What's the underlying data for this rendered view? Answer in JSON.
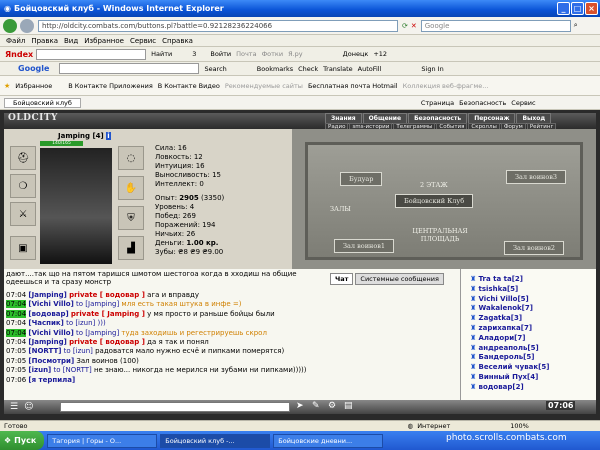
{
  "window": {
    "title": "Бойцовский клуб - Windows Internet Explorer"
  },
  "address": {
    "url": "http://oldcity.combats.com/buttons.pl?battle=0.92128236224066",
    "search_placeholder": "Google"
  },
  "menu": [
    "Файл",
    "Правка",
    "Вид",
    "Избранное",
    "Сервис",
    "Справка"
  ],
  "yandex_bar": {
    "logo": "Яndex",
    "find": "Найти",
    "count": "3",
    "login": "Войти",
    "mail": "Почта",
    "photo": "Фотки",
    "yaru": "Я.ру",
    "city": "Донецк",
    "temp": "+12"
  },
  "google_bar": {
    "logo": "Google",
    "search": "Search",
    "bookmarks": "Bookmarks",
    "check": "Check",
    "translate": "Translate",
    "autofill": "AutoFill",
    "signin": "Sign In"
  },
  "fav_bar": {
    "fav": "Избранное",
    "items": [
      "В Контакте Приложения",
      "В Контакте Видео",
      "Рекомендуемые сайты",
      "Бесплатная почта Hotmail",
      "Коллекция веб-фрагме..."
    ]
  },
  "tab": {
    "title": "Бойцовский клуб",
    "page": "Страница",
    "safety": "Безопасность",
    "service": "Сервис"
  },
  "game": {
    "logo": "OLDCITY",
    "nav1": [
      "Знания",
      "Общение",
      "Безопасность",
      "Персонаж",
      "Выход"
    ],
    "nav2": [
      "Радио",
      "sms-истории",
      "Телеграммы",
      "События",
      "Скроллы",
      "Форум",
      "Рейтинг"
    ],
    "char": {
      "name": "Jamping",
      "level": "[4]",
      "hp": "140/165"
    },
    "stats": [
      "Сила: 16",
      "Ловкость: 12",
      "Интуиция: 16",
      "Выносливость: 15",
      "Интеллект: 0"
    ],
    "stats2": [
      "Уровень: 4",
      "Побед: 269",
      "Поражений: 194",
      "Ничьих: 26"
    ],
    "exp_label": "Опыт:",
    "exp_value": "2905",
    "exp_next": "(3350)",
    "money_label": "Деньги:",
    "money_value": "1.00 кр.",
    "teeth": "Зубы: ₴8 ₴9 ₴9.00",
    "map": {
      "bar": "Будуар",
      "hall": "Зал воинов3",
      "floor": "2 ЭТАЖ",
      "club": "Бойцовский Клуб",
      "halls": "ЗАЛЫ",
      "hall1": "Зал воинов1",
      "central": "ЦЕНТРАЛЬНАЯ ПЛОЩАДЬ",
      "hall2": "Зал воинов2"
    }
  },
  "chat": {
    "top": "дают....так що на пятом таришся шмотом шестогоа когда в хходиш на общие  одеешься и та сразу монстр",
    "tabs": [
      "Чат",
      "Системные сообщения"
    ],
    "lines": [
      {
        "t": "07:04",
        "n": "[Jamping]",
        "p": "private [ водовар ]",
        "m": "ага и вправду",
        "mo": false,
        "g": false
      },
      {
        "t": "07:04",
        "n": "[Vichi Villo]",
        "to": "to [Jamping]",
        "m": "мля есть такая штука в инфе =)",
        "mo": true,
        "g": true
      },
      {
        "t": "07:04",
        "n": "[водовар]",
        "p": "private [ Jamping ]",
        "m": "у мя просто и раньше бойцы были",
        "mo": false,
        "g": true
      },
      {
        "t": "07:04",
        "n": "[Часпик]",
        "to": "to [izun] )))",
        "m": "",
        "mo": false,
        "g": false
      },
      {
        "t": "07:04",
        "n": "[Vichi Villo]",
        "to": "to [Jamping]",
        "m": "туда заходишь и регестрируешь скрол",
        "mo": true,
        "g": true
      },
      {
        "t": "07:04",
        "n": "[Jamping]",
        "p": "private [ водовар ]",
        "m": "да я так и понял",
        "mo": false,
        "g": false
      },
      {
        "t": "07:05",
        "n": "[NORTT]",
        "to": "to [izun]",
        "m": "радоватся мало нужно есчё и пипками померятся)",
        "mo": false,
        "g": false
      },
      {
        "t": "07:05",
        "n": "[Посмотри]",
        "m": "Зал воинов (100)",
        "mo": false,
        "g": false
      },
      {
        "t": "07:05",
        "n": "[izun]",
        "to": "to [NORTT]",
        "m": "не знаю... никогда не мерился ни зубами ни пипками)))))",
        "mo": false,
        "g": false
      },
      {
        "t": "07:06",
        "n": "[я терпила]",
        "m": "",
        "mo": false,
        "g": false
      }
    ]
  },
  "users": [
    "Tra ta ta[2]",
    "tsishka[5]",
    "Vichi Villo[5]",
    "Wakalenok[7]",
    "Zagatka[3]",
    "zaрихапка[7]",
    "Аладори[7]",
    "андреаполь[5]",
    "Бандероль[5]",
    "Веселий чувак[5]",
    "Винный Пух[4]",
    "водовар[2]"
  ],
  "clock": "07:06",
  "status": {
    "ready": "Готово",
    "zone": "Интернет",
    "zoom": "100%"
  },
  "taskbar": {
    "start": "Пуск",
    "tasks": [
      "Тагория | Горы - О...",
      "Бойцовский клуб -...",
      "Бойцовские дневни..."
    ],
    "tray": "photo.scrolls.combats.com"
  }
}
